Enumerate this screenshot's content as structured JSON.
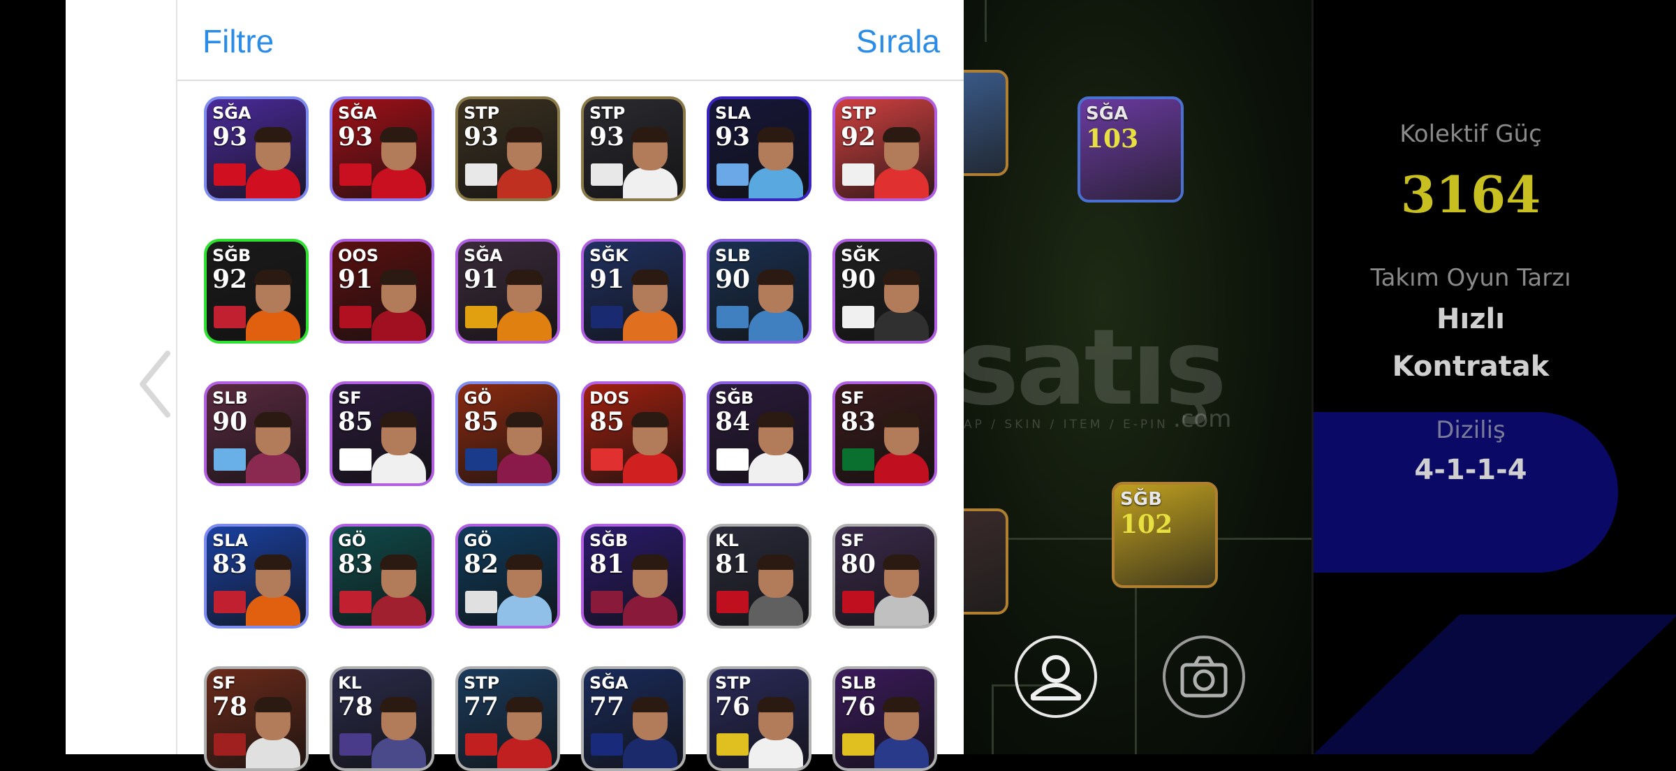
{
  "panel": {
    "filter_label": "Filtre",
    "sort_label": "Sırala"
  },
  "players": [
    {
      "pos": "SĞA",
      "rating": "93",
      "border": "#7e8cf0",
      "bg": "#4a2a9a",
      "shirt": "#d01020",
      "badge": "#d01020"
    },
    {
      "pos": "SĞA",
      "rating": "93",
      "border": "#8a7cf0",
      "bg": "#a01018",
      "shirt": "#c81020",
      "badge": "#c81020"
    },
    {
      "pos": "STP",
      "rating": "93",
      "border": "#8a7a4a",
      "bg": "#3a3020",
      "shirt": "#c03020",
      "badge": "#e8e8e8"
    },
    {
      "pos": "STP",
      "rating": "93",
      "border": "#8a7a4a",
      "bg": "#2a2a30",
      "shirt": "#f0f0f0",
      "badge": "#e8e8e8"
    },
    {
      "pos": "SLA",
      "rating": "93",
      "border": "#3a24c0",
      "bg": "#16163a",
      "shirt": "#5aa8e0",
      "badge": "#6aa8e8"
    },
    {
      "pos": "STP",
      "rating": "92",
      "border": "#b060e0",
      "bg": "#d04040",
      "shirt": "#e03030",
      "badge": "#f0f0f0"
    },
    {
      "pos": "SĞB",
      "rating": "92",
      "border": "#30e030",
      "bg": "#1a1a1a",
      "shirt": "#e06010",
      "badge": "#c02030"
    },
    {
      "pos": "OOS",
      "rating": "91",
      "border": "#b060e0",
      "bg": "#5a1010",
      "shirt": "#a01020",
      "badge": "#b01020"
    },
    {
      "pos": "SĞA",
      "rating": "91",
      "border": "#b060e0",
      "bg": "#3a2a3a",
      "shirt": "#e08010",
      "badge": "#e0a010"
    },
    {
      "pos": "SĞK",
      "rating": "91",
      "border": "#b060e0",
      "bg": "#203060",
      "shirt": "#e07020",
      "badge": "#1a2a70"
    },
    {
      "pos": "SLB",
      "rating": "90",
      "border": "#8a60e0",
      "bg": "#1a3050",
      "shirt": "#4080c0",
      "badge": "#4080c0"
    },
    {
      "pos": "SĞK",
      "rating": "90",
      "border": "#b060e0",
      "bg": "#202020",
      "shirt": "#303030",
      "badge": "#f0f0f0"
    },
    {
      "pos": "SLB",
      "rating": "90",
      "border": "#b060e0",
      "bg": "#5a2a40",
      "shirt": "#8a2a50",
      "badge": "#6ab0e8"
    },
    {
      "pos": "SF",
      "rating": "85",
      "border": "#b060e0",
      "bg": "#2a1a3a",
      "shirt": "#f0f0f0",
      "badge": "#ffffff"
    },
    {
      "pos": "GÖ",
      "rating": "85",
      "border": "#7e8cf0",
      "bg": "#8a2a10",
      "shirt": "#8a1a4a",
      "badge": "#1a3a8a"
    },
    {
      "pos": "DOS",
      "rating": "85",
      "border": "#b060e0",
      "bg": "#a02010",
      "shirt": "#d02020",
      "badge": "#e03030"
    },
    {
      "pos": "SĞB",
      "rating": "84",
      "border": "#8a60e0",
      "bg": "#2a1a3a",
      "shirt": "#f0f0f0",
      "badge": "#ffffff"
    },
    {
      "pos": "SF",
      "rating": "83",
      "border": "#b060e0",
      "bg": "#3a1a1a",
      "shirt": "#c01020",
      "badge": "#0a7030"
    },
    {
      "pos": "SLA",
      "rating": "83",
      "border": "#7e8cf0",
      "bg": "#1a40a0",
      "shirt": "#e06010",
      "badge": "#c02030"
    },
    {
      "pos": "GÖ",
      "rating": "83",
      "border": "#b060e0",
      "bg": "#104a4a",
      "shirt": "#a02030",
      "badge": "#c02030"
    },
    {
      "pos": "GÖ",
      "rating": "82",
      "border": "#b060e0",
      "bg": "#103a5a",
      "shirt": "#90c0e8",
      "badge": "#e0e0e0"
    },
    {
      "pos": "SĞB",
      "rating": "81",
      "border": "#b060e0",
      "bg": "#2a1a6a",
      "shirt": "#8a1a3a",
      "badge": "#8a1a3a"
    },
    {
      "pos": "KL",
      "rating": "81",
      "border": "#b0b0b0",
      "bg": "#2a2a3a",
      "shirt": "#606060",
      "badge": "#c01020"
    },
    {
      "pos": "SF",
      "rating": "80",
      "border": "#b0b0b0",
      "bg": "#3a2a4a",
      "shirt": "#c0c0c0",
      "badge": "#c01020"
    },
    {
      "pos": "SF",
      "rating": "78",
      "border": "#b0b0b0",
      "bg": "#6a2a1a",
      "shirt": "#e0e0e0",
      "badge": "#a02020"
    },
    {
      "pos": "KL",
      "rating": "78",
      "border": "#b0b0b0",
      "bg": "#2a2a4a",
      "shirt": "#4a4a8a",
      "badge": "#4a3a8a"
    },
    {
      "pos": "STP",
      "rating": "77",
      "border": "#b0b0b0",
      "bg": "#1a3a5a",
      "shirt": "#c02020",
      "badge": "#c02020"
    },
    {
      "pos": "SĞA",
      "rating": "77",
      "border": "#b0b0b0",
      "bg": "#1a2a5a",
      "shirt": "#1a2a6a",
      "badge": "#1a2a7a"
    },
    {
      "pos": "STP",
      "rating": "76",
      "border": "#b0b0b0",
      "bg": "#2a2a5a",
      "shirt": "#f0f0f0",
      "badge": "#e0c020"
    },
    {
      "pos": "SLB",
      "rating": "76",
      "border": "#b0b0b0",
      "bg": "#3a1a5a",
      "shirt": "#2a3a8a",
      "badge": "#e0c020"
    }
  ],
  "field_players": [
    {
      "pos": "",
      "rating": "",
      "border": "#b08030",
      "bg": "#3a5a8a"
    },
    {
      "pos": "SĞA",
      "rating": "103",
      "border": "#4a70d0",
      "bg": "#6a3aa0"
    },
    {
      "pos": "",
      "rating": "",
      "border": "#b08030",
      "bg": "#3a2a2a"
    },
    {
      "pos": "SĞB",
      "rating": "102",
      "border": "#b08030",
      "bg": "#c0a020"
    }
  ],
  "watermark": {
    "text": "satış",
    "com": ".com",
    "tag": "AP / SKIN / ITEM / E-PIN"
  },
  "info": {
    "power_label": "Kolektif Güç",
    "power_value": "3164",
    "style_label": "Takım Oyun Tarzı",
    "style_value_1": "Hızlı",
    "style_value_2": "Kontratak",
    "formation_label": "Diziliş",
    "formation_value": "4-1-1-4"
  },
  "icons": {
    "profile": "user-icon",
    "camera": "camera-icon",
    "back": "chevron-left-icon"
  }
}
